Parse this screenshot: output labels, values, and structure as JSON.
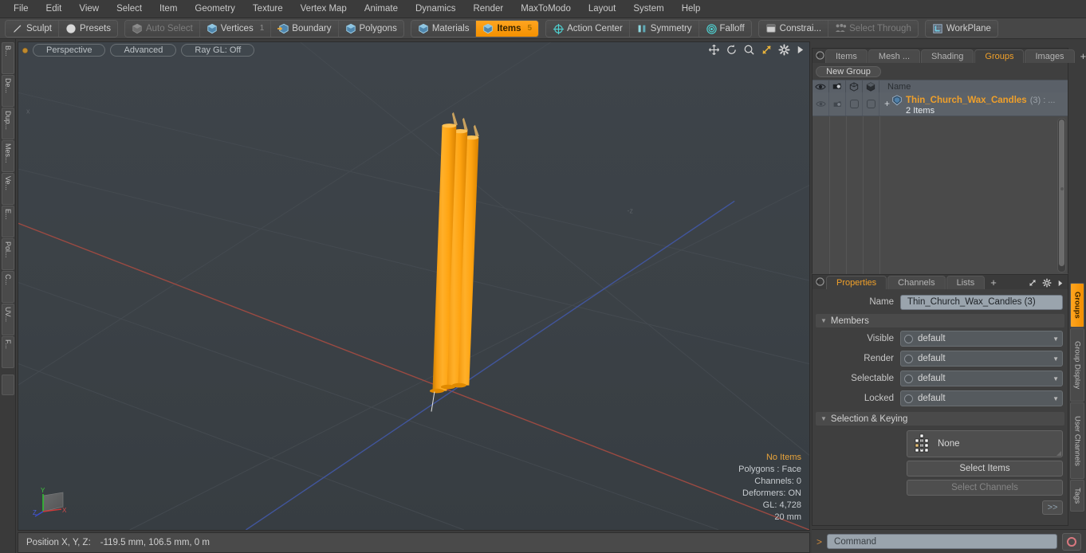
{
  "menu": {
    "items": [
      "File",
      "Edit",
      "View",
      "Select",
      "Item",
      "Geometry",
      "Texture",
      "Vertex Map",
      "Animate",
      "Dynamics",
      "Render",
      "MaxToModo",
      "Layout",
      "System",
      "Help"
    ]
  },
  "toolbar": {
    "groups": [
      {
        "buttons": [
          {
            "label": "Sculpt",
            "icon": "pencil-icon",
            "state": "normal"
          },
          {
            "label": "Presets",
            "icon": "sphere-icon",
            "state": "normal"
          }
        ]
      },
      {
        "buttons": [
          {
            "label": "Auto Select",
            "icon": "cube-gray-icon",
            "state": "disabled"
          },
          {
            "label": "Vertices",
            "icon": "cube-blue-icon",
            "state": "normal",
            "num": "1"
          },
          {
            "label": "Boundary",
            "icon": "cube-arrow-icon",
            "state": "normal"
          },
          {
            "label": "Polygons",
            "icon": "cube-blue-icon",
            "state": "normal"
          }
        ]
      },
      {
        "buttons": [
          {
            "label": "Materials",
            "icon": "cube-blue-icon",
            "state": "normal"
          },
          {
            "label": "Items",
            "icon": "cube-blue-icon",
            "state": "active",
            "num": "5"
          }
        ]
      },
      {
        "buttons": [
          {
            "label": "Action Center",
            "icon": "target-icon",
            "state": "normal"
          },
          {
            "label": "Symmetry",
            "icon": "symmetry-icon",
            "state": "normal"
          },
          {
            "label": "Falloff",
            "icon": "falloff-icon",
            "state": "normal"
          }
        ]
      },
      {
        "buttons": [
          {
            "label": "Constrai...",
            "icon": "plane-icon",
            "state": "normal"
          },
          {
            "label": "Select Through",
            "icon": "select-through-icon",
            "state": "disabled"
          }
        ]
      },
      {
        "buttons": [
          {
            "label": "WorkPlane",
            "icon": "workplane-icon",
            "state": "normal"
          }
        ]
      }
    ]
  },
  "left_tabs": [
    "B...",
    "De...",
    "Dup...",
    "Mes...",
    "Ve...",
    "E...",
    "Pol...",
    "C...",
    "UV...",
    "F..."
  ],
  "viewport": {
    "dot": "viewport-indicator",
    "pills": [
      "Perspective",
      "Advanced",
      "Ray GL: Off"
    ],
    "header_icons": [
      "move-icon",
      "rotate-icon",
      "zoom-icon",
      "fit-icon",
      "gear-icon",
      "play-arrow-icon"
    ],
    "overlay": {
      "no_items": "No Items",
      "polygons": "Polygons : Face",
      "channels": "Channels: 0",
      "deformers": "Deformers: ON",
      "gl": "GL: 4,728",
      "scale": "20 mm"
    },
    "gizmo": {
      "x": "X",
      "y": "Y",
      "z": "Z"
    },
    "scene": {
      "object_color": "#ffa411",
      "object_shadow": "#d98200",
      "background": "#3b4247",
      "axis_x_color": "#a14b42",
      "axis_z_color": "#4257a1",
      "candles": 3
    }
  },
  "groups_panel": {
    "tabs": [
      {
        "label": "Items",
        "active": false
      },
      {
        "label": "Mesh ...",
        "active": false
      },
      {
        "label": "Shading",
        "active": false
      },
      {
        "label": "Groups",
        "active": true
      },
      {
        "label": "Images",
        "active": false
      }
    ],
    "tab_plus": "+",
    "new_group_button": "New Group",
    "columns": [
      "eye-icon",
      "render-icon",
      "cube-outline-icon",
      "cube-solid-icon",
      "Name"
    ],
    "name_header": "Name",
    "rows": [
      {
        "expander": "+",
        "icon": "group-shield-icon",
        "name": "Thin_Church_Wax_Candles",
        "count": "(3) : ...",
        "subtitle": "2 Items"
      }
    ]
  },
  "properties_panel": {
    "tabs": [
      {
        "label": "Properties",
        "active": true
      },
      {
        "label": "Channels",
        "active": false
      },
      {
        "label": "Lists",
        "active": false
      }
    ],
    "tab_plus": "+",
    "name_label": "Name",
    "name_value": "Thin_Church_Wax_Candles (3)",
    "members_section": "Members",
    "member_rows": [
      {
        "label": "Visible",
        "value": "default"
      },
      {
        "label": "Render",
        "value": "default"
      },
      {
        "label": "Selectable",
        "value": "default"
      },
      {
        "label": "Locked",
        "value": "default"
      }
    ],
    "selection_section": "Selection & Keying",
    "selection_value": "None",
    "selection_icon": "keying-grid-icon",
    "select_items_button": "Select Items",
    "select_channels_button": "Select Channels",
    "more_button": ">>"
  },
  "right_tabs": [
    {
      "label": "Groups",
      "active": true
    },
    {
      "label": "Group Display",
      "active": false
    },
    {
      "label": "User Channels",
      "active": false
    },
    {
      "label": "Tags",
      "active": false
    }
  ],
  "statusbar": {
    "position_label": "Position X, Y, Z:",
    "position_value": "-119.5 mm, 106.5 mm, 0 m"
  },
  "command_bar": {
    "prompt": ">",
    "placeholder": "Command",
    "record_button": "record-icon"
  },
  "theme": {
    "accent": "#f0a02a",
    "panel_bg": "#3f3f3f",
    "viewport_bg": "#3b4247",
    "list_bg": "#5c6269"
  }
}
